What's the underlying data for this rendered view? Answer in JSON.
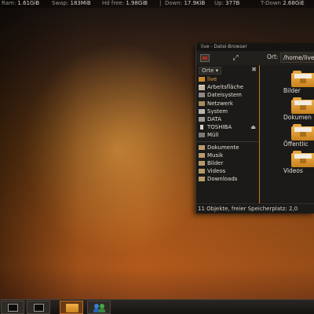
{
  "conky": {
    "ram_label": "Ram:",
    "ram_value": "1.61GiB",
    "swap_label": "Swap:",
    "swap_value": "183MiB",
    "hd_label": "Hd free:",
    "hd_value": "1.98GiB",
    "down_label": "Down:",
    "down_value": "17.9KiB",
    "up_label": "Up:",
    "up_value": "377B",
    "tdown_label": "T-Down",
    "tdown_value": "2.68GiE"
  },
  "window": {
    "title": "live - Datei-Browser",
    "toolbar": {
      "terminal_icon": "terminal-icon",
      "expand_icon": "expand-icon",
      "location_label": "Ort:",
      "location_value": "/home/live"
    },
    "sidebar": {
      "header": "Orte",
      "places": [
        {
          "label": "live",
          "icon": "home-folder-icon"
        },
        {
          "label": "Arbeitsfläche",
          "icon": "desktop-icon"
        },
        {
          "label": "Dateisystem",
          "icon": "filesystem-icon"
        },
        {
          "label": "Netzwerk",
          "icon": "network-icon"
        },
        {
          "label": "System",
          "icon": "drive-icon"
        },
        {
          "label": "DATA",
          "icon": "drive-icon"
        },
        {
          "label": "TOSHIBA",
          "icon": "usb-drive-icon"
        },
        {
          "label": "Müll",
          "icon": "trash-icon"
        }
      ],
      "bookmarks": [
        {
          "label": "Dokumente",
          "icon": "folder-icon"
        },
        {
          "label": "Musik",
          "icon": "folder-icon"
        },
        {
          "label": "Bilder",
          "icon": "folder-icon"
        },
        {
          "label": "Videos",
          "icon": "folder-icon"
        },
        {
          "label": "Downloads",
          "icon": "folder-icon"
        }
      ]
    },
    "files": [
      {
        "label": "Bilder"
      },
      {
        "label": "Dokumen"
      },
      {
        "label": "Öffentlic"
      },
      {
        "label": "Videos"
      }
    ],
    "status": "11 Objekte, freier Speicherplatz: 2,0"
  },
  "taskbar": {
    "items": [
      {
        "icon": "terminal-icon"
      },
      {
        "icon": "terminal-icon"
      },
      {
        "icon": "file-manager-icon"
      },
      {
        "icon": "users-icon"
      }
    ]
  },
  "colors": {
    "accent": "#c07a1a",
    "active_place": "#e9a23a"
  }
}
